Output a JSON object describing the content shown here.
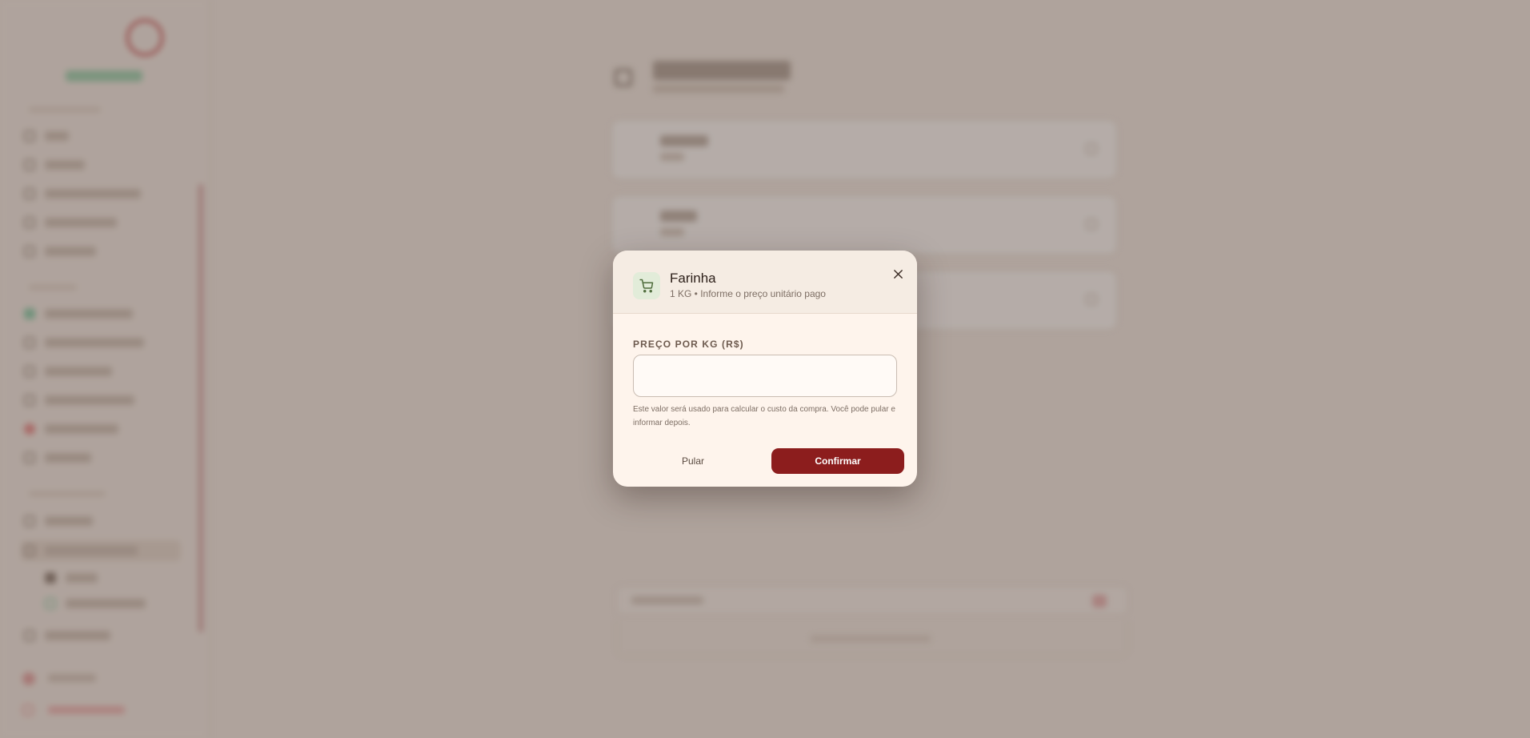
{
  "modal": {
    "title": "Farinha",
    "subtitle": "1 KG • Informe o preço unitário pago",
    "field_label": "PREÇO POR KG (R$)",
    "price_value": "",
    "price_placeholder": "",
    "hint": "Este valor será usado para calcular o custo da compra. Você pode pular e informar depois.",
    "skip_label": "Pular",
    "confirm_label": "Confirmar",
    "icon": "shopping-cart-icon",
    "close_icon": "close-icon"
  },
  "colors": {
    "accent": "#8c1d1d",
    "modal_background": "#fef4ec",
    "cart_badge": "#e2ecd9",
    "cart_icon": "#4d6b3a",
    "overlay": "rgba(72, 56, 48, 0.40)"
  }
}
